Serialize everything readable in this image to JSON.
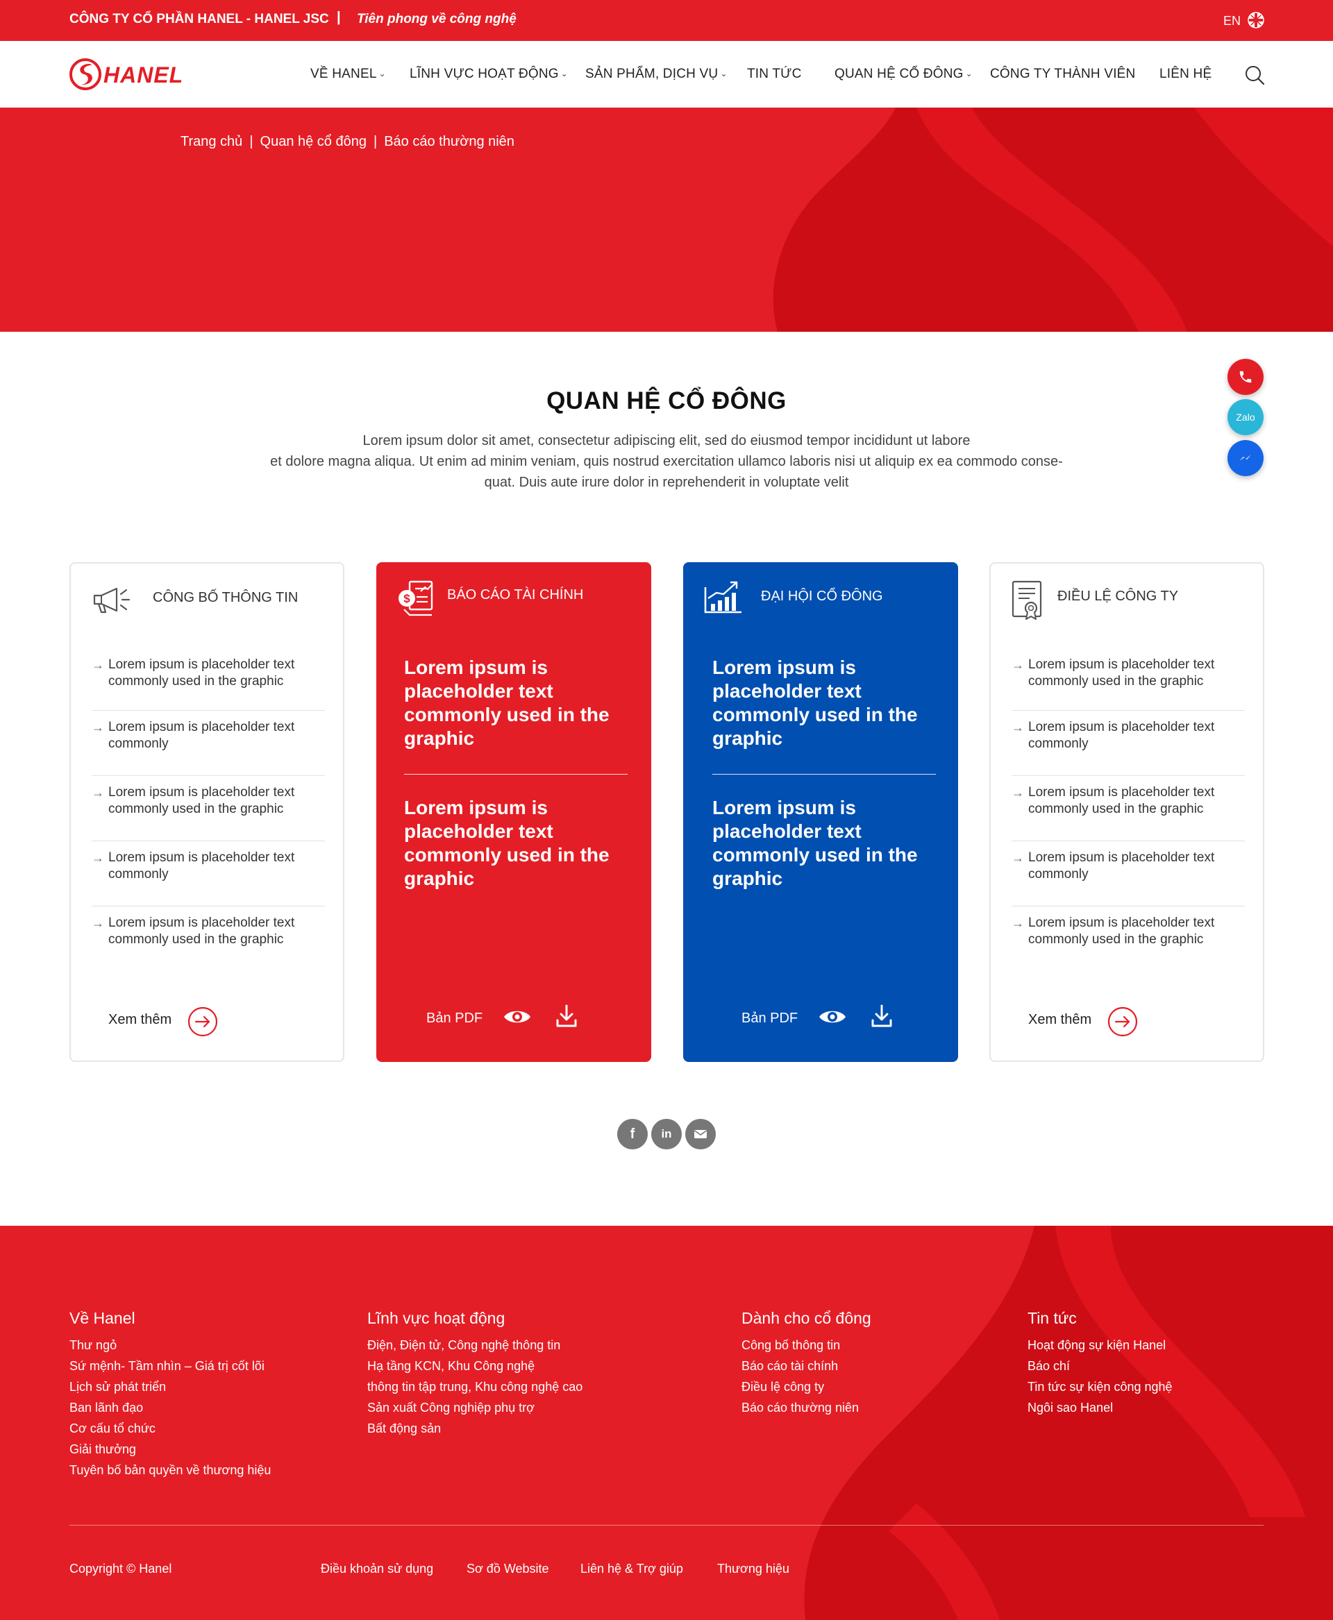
{
  "topbar": {
    "company": "CÔNG TY CỔ PHẦN HANEL - HANEL JSC",
    "separator": "|",
    "slogan": "Tiên phong về công nghệ",
    "lang": "EN"
  },
  "brand": {
    "logo_text": "HANEL",
    "color": "#e41e26",
    "blue": "#014fb0"
  },
  "nav": {
    "items": [
      {
        "label": "VỀ HANEL",
        "dropdown": true
      },
      {
        "label": "LĨNH VỰC HOẠT ĐỘNG",
        "dropdown": true
      },
      {
        "label": "SẢN PHẨM, DỊCH VỤ",
        "dropdown": true
      },
      {
        "label": "TIN TỨC",
        "dropdown": false
      },
      {
        "label": "QUAN HỆ CỔ ĐÔNG",
        "dropdown": true
      },
      {
        "label": "CÔNG TY THÀNH VIÊN",
        "dropdown": false
      },
      {
        "label": "LIÊN HỆ",
        "dropdown": false
      }
    ],
    "chevron": "⌄"
  },
  "breadcrumb": {
    "items": [
      "Trang chủ",
      "Quan hệ cổ đông",
      "Báo cáo thường niên"
    ],
    "separator": "|"
  },
  "float": {
    "zalo": "Zalo"
  },
  "section": {
    "title": "QUAN HỆ CỔ ĐÔNG",
    "intro_lines": [
      "Lorem ipsum dolor sit amet, consectetur adipiscing elit, sed do eiusmod tempor incididunt ut labore",
      "et dolore magna aliqua. Ut enim ad minim veniam, quis nostrud exercitation ullamco laboris nisi ut aliquip ex ea commodo conse-",
      "quat. Duis aute irure dolor in reprehenderit in voluptate velit"
    ]
  },
  "cards": [
    {
      "title": "CÔNG BỐ THÔNG TIN",
      "icon": "megaphone-icon",
      "items": [
        "Lorem ipsum is placeholder text commonly used in the graphic",
        "Lorem ipsum is placeholder text commonly",
        "Lorem ipsum is placeholder text commonly used in the graphic",
        "Lorem ipsum is placeholder text commonly",
        "Lorem ipsum is placeholder text commonly used in the graphic"
      ],
      "more": "Xem thêm"
    },
    {
      "title": "BÁO CÁO TÀI CHÍNH",
      "icon": "financial-report-icon",
      "blocks": [
        "Lorem ipsum is placeholder text commonly used in the graphic",
        "Lorem ipsum is placeholder text commonly used in the graphic"
      ],
      "pdf": "Bản PDF"
    },
    {
      "title": "ĐẠI HỘI CỔ ĐÔNG",
      "icon": "growth-chart-icon",
      "blocks": [
        "Lorem ipsum is placeholder text commonly used in the graphic",
        "Lorem ipsum is placeholder text commonly used in the graphic"
      ],
      "pdf": "Bản PDF"
    },
    {
      "title": "ĐIỀU LỆ CÔNG TY",
      "icon": "certificate-icon",
      "items": [
        "Lorem ipsum is placeholder text commonly used in the graphic",
        "Lorem ipsum is placeholder text commonly",
        "Lorem ipsum is placeholder text commonly used in the graphic",
        "Lorem ipsum is placeholder text commonly",
        "Lorem ipsum is placeholder text commonly used in the graphic"
      ],
      "more": "Xem thêm"
    }
  ],
  "social": {
    "facebook": "f",
    "linkedin": "in"
  },
  "footer": {
    "columns": [
      {
        "title": "Về Hanel",
        "links": [
          "Thư ngỏ",
          "Sứ mệnh- Tầm nhìn – Giá trị cốt lõi",
          "Lịch sử phát triển",
          "Ban lãnh đạo",
          "Cơ cấu tổ chức",
          "Giải thưởng",
          "Tuyên bố bản quyền về thương hiệu"
        ]
      },
      {
        "title": "Lĩnh vực hoạt động",
        "links": [
          "Điện, Điện tử, Công nghệ thông tin",
          "Hạ tầng KCN, Khu Công nghệ",
          "thông tin tập trung, Khu công nghệ cao",
          "Sản xuất Công nghiệp phụ trợ",
          "Bất động sản"
        ]
      },
      {
        "title": "Dành cho cổ đông",
        "links": [
          "Công bố thông tin",
          "Báo cáo tài chính",
          "Điều lệ công ty",
          "Báo cáo thường niên"
        ]
      },
      {
        "title": "Tin tức",
        "links": [
          "Hoạt động sự kiện Hanel",
          "Báo chí",
          "Tin tức sự kiện công nghệ",
          "Ngôi sao Hanel"
        ]
      }
    ],
    "copyright": "Copyright © Hanel",
    "bottom_links": [
      "Điều khoản sử dụng",
      "Sơ đồ Website",
      "Liên hệ & Trợ giúp",
      "Thương hiệu"
    ]
  }
}
